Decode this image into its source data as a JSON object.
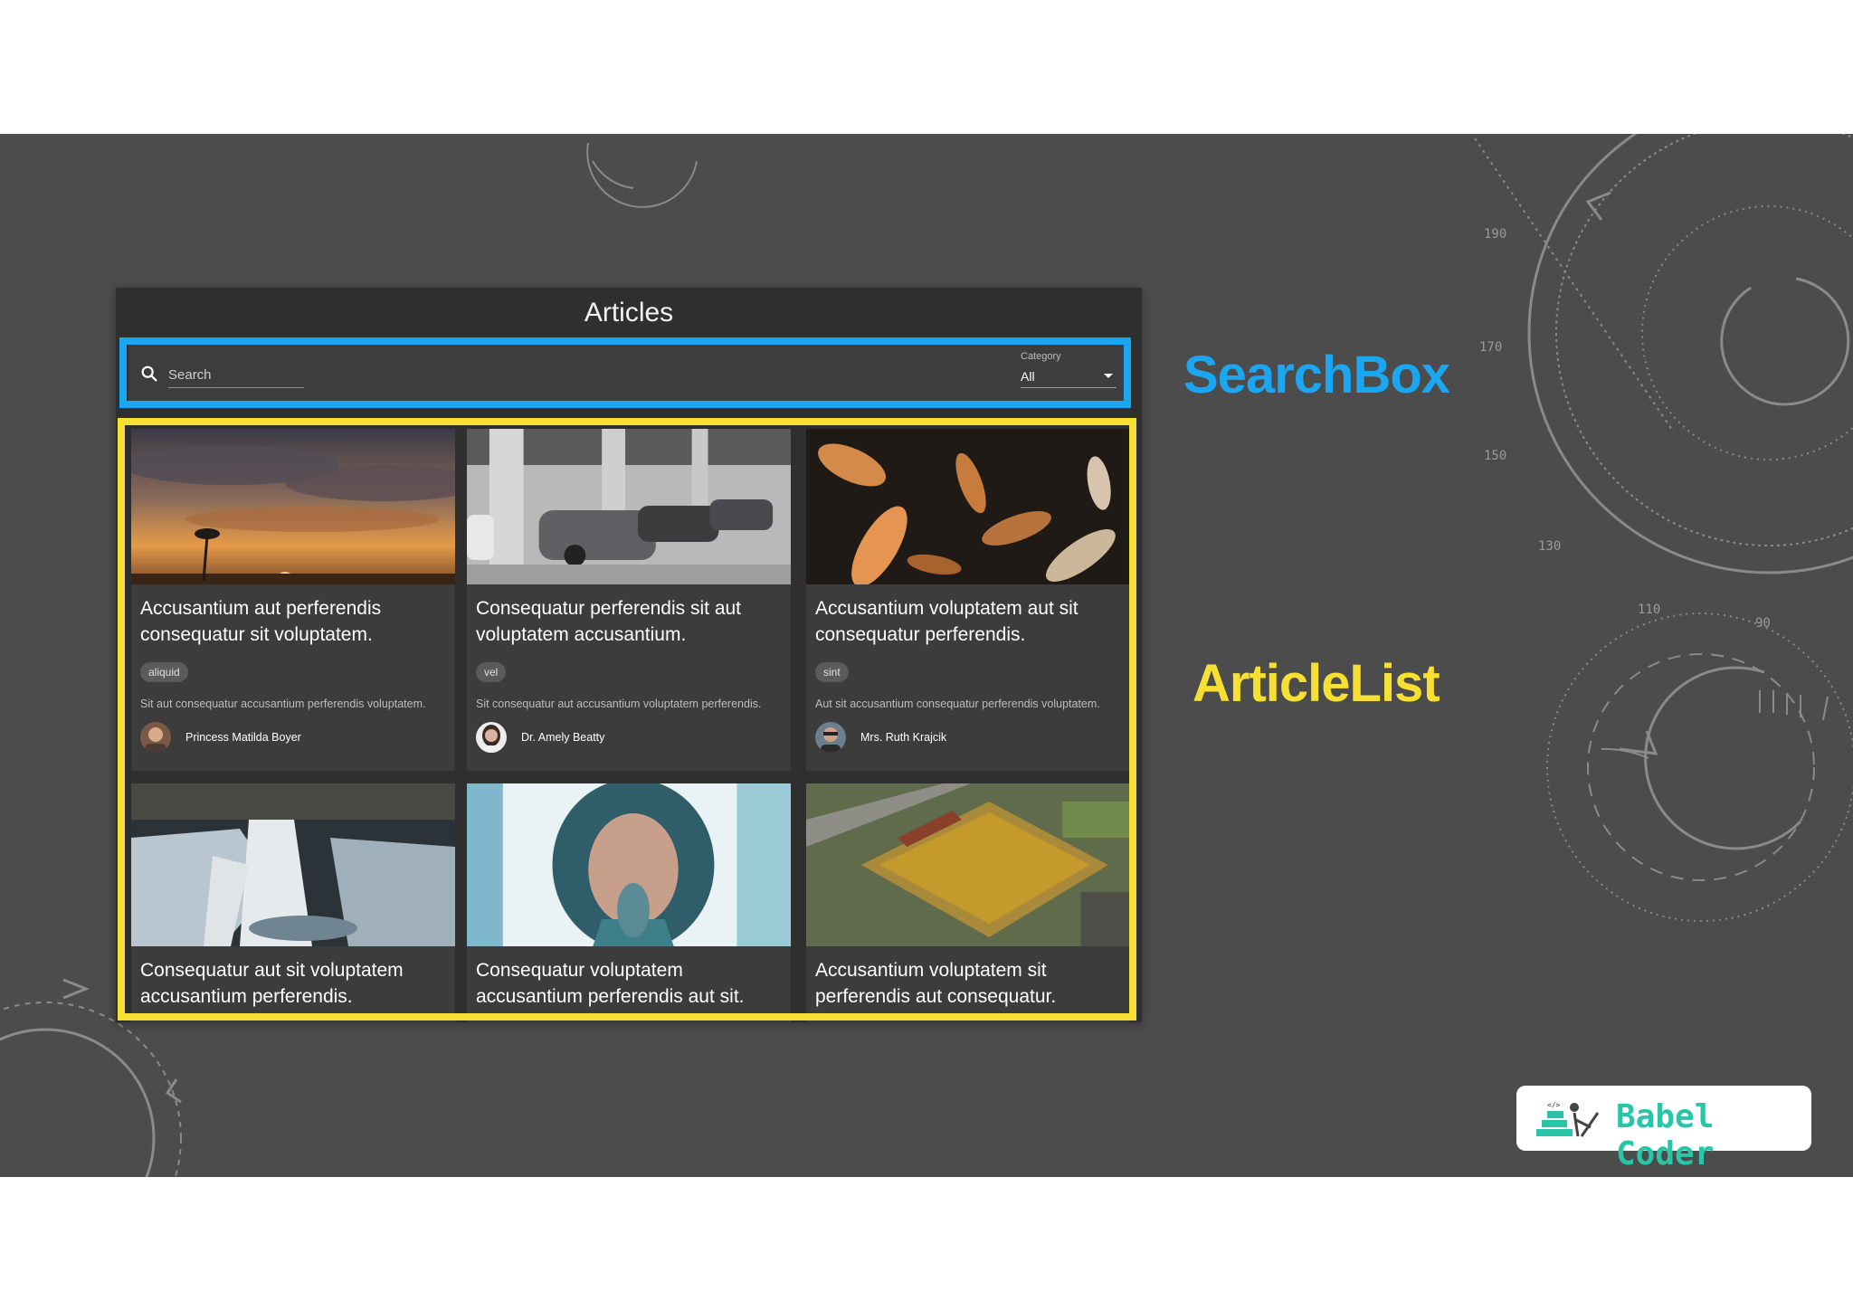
{
  "app": {
    "title": "Articles"
  },
  "search": {
    "placeholder": "Search",
    "category_label": "Category",
    "category_value": "All"
  },
  "articles": [
    {
      "title": "Accusantium aut perferendis consequatur sit voluptatem.",
      "tag": "aliquid",
      "excerpt": "Sit aut consequatur accusantium perferendis voluptatem.",
      "author": "Princess Matilda Boyer",
      "image": "sunset-palm-photo"
    },
    {
      "title": "Consequatur perferendis sit aut voluptatem accusantium.",
      "tag": "vel",
      "excerpt": "Sit consequatur aut accusantium voluptatem perferendis.",
      "author": "Dr. Amely Beatty",
      "image": "parking-garage-photo"
    },
    {
      "title": "Accusantium voluptatem aut sit consequatur perferendis.",
      "tag": "sint",
      "excerpt": "Aut sit accusantium consequatur perferendis voluptatem.",
      "author": "Mrs. Ruth Krajcik",
      "image": "koi-fish-photo"
    },
    {
      "title": "Consequatur aut sit voluptatem accusantium perferendis.",
      "image": "waterfall-photo"
    },
    {
      "title": "Consequatur voluptatem accusantium perferendis aut sit.",
      "image": "woman-portrait-photo"
    },
    {
      "title": "Accusantium voluptatem sit perferendis aut consequatur.",
      "image": "construction-aerial-photo"
    }
  ],
  "annotations": {
    "searchbox_label": "SearchBox",
    "articlelist_label": "ArticleList",
    "searchbox_color": "#1aa6f0",
    "articlelist_color": "#f7e033"
  },
  "logo": {
    "text": "Babel Coder",
    "color": "#2ac4a8"
  }
}
